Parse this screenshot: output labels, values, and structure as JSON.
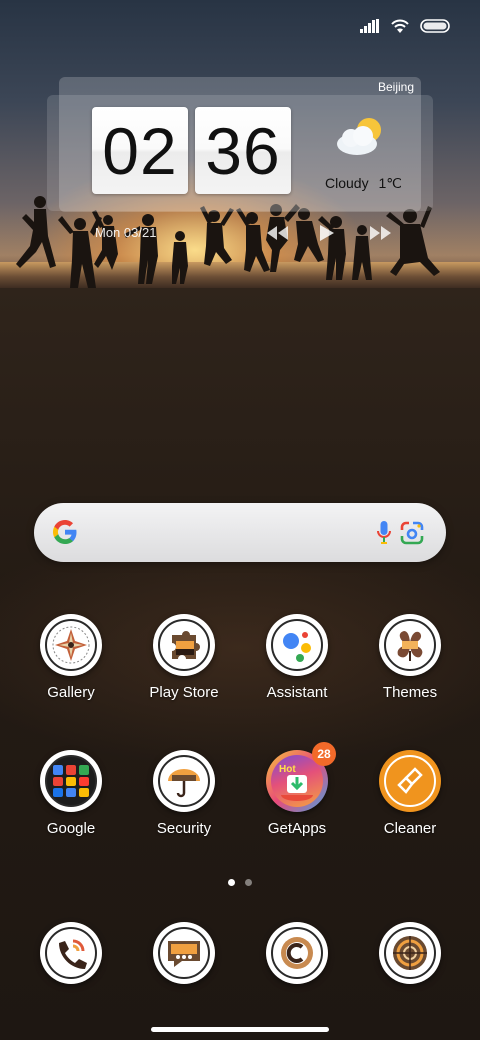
{
  "status_bar": {
    "signal_icon": "cellular-signal-icon",
    "wifi_icon": "wifi-icon",
    "battery_icon": "battery-icon"
  },
  "clock_widget": {
    "city": "Beijing",
    "hours": "02",
    "minutes": "36",
    "weather": "Cloudy",
    "temperature": "1℃",
    "weather_icon": "partly-cloudy-icon",
    "date": "Mon 03/21"
  },
  "media_controls": {
    "previous_icon": "previous-track-icon",
    "play_icon": "play-icon",
    "next_icon": "next-track-icon"
  },
  "search": {
    "logo": "google-g-icon",
    "mic_icon": "microphone-icon",
    "lens_icon": "google-lens-icon",
    "colors": {
      "blue": "#4285F4",
      "red": "#EA4335",
      "yellow": "#FBBC05",
      "green": "#34A853"
    }
  },
  "apps": {
    "row1": [
      {
        "label": "Gallery"
      },
      {
        "label": "Play Store"
      },
      {
        "label": "Assistant"
      },
      {
        "label": "Themes"
      }
    ],
    "row2": [
      {
        "label": "Google"
      },
      {
        "label": "Security"
      },
      {
        "label": "GetApps",
        "badge": "28",
        "icon_text": "Hot"
      },
      {
        "label": "Cleaner"
      }
    ]
  },
  "page_indicator": {
    "pages": 2,
    "current": 1
  },
  "dock": [
    {
      "icon": "phone-icon"
    },
    {
      "icon": "messages-icon"
    },
    {
      "icon": "browser-icon"
    },
    {
      "icon": "camera-icon"
    }
  ],
  "accent_colors": {
    "badge": "#f26a2a",
    "cleaner": "#f0941e"
  }
}
